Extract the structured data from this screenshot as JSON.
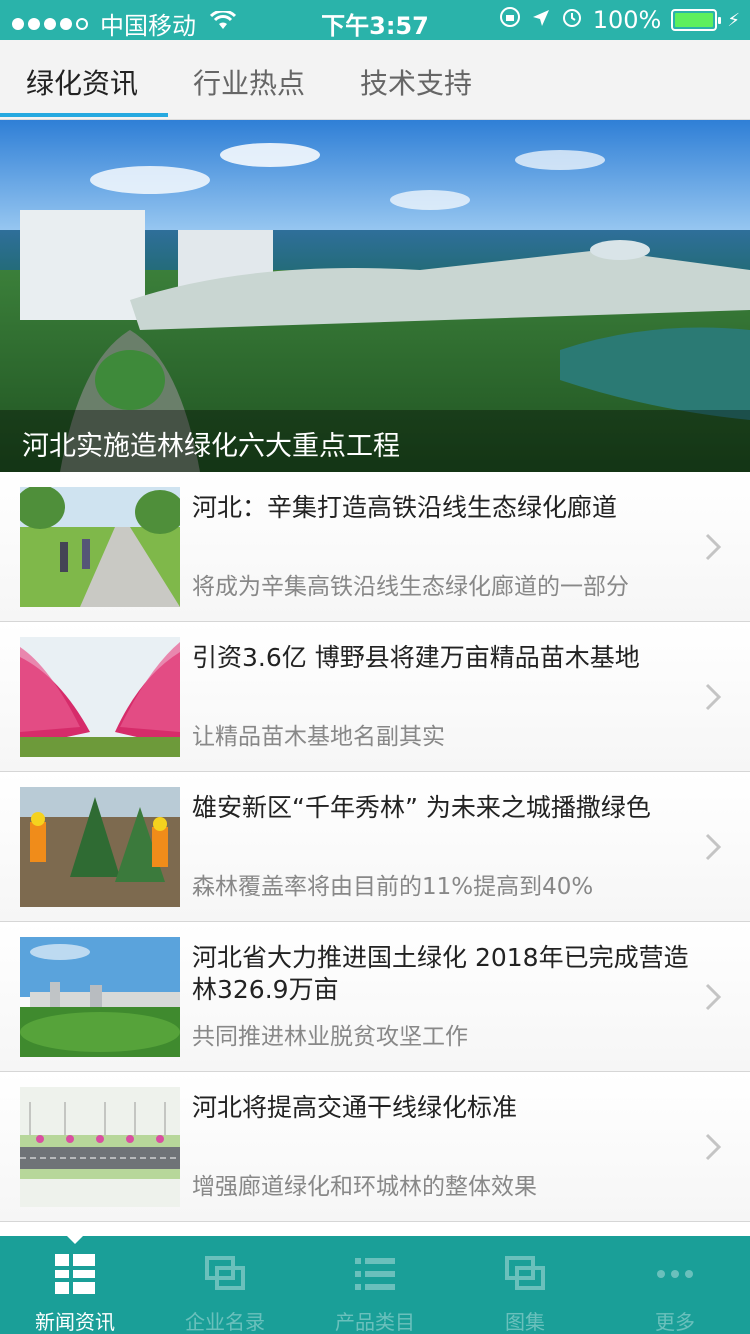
{
  "status_bar": {
    "carrier": "中国移动",
    "time": "下午3:57",
    "battery_percent": "100%",
    "battery_level": 1.0
  },
  "tabs": [
    {
      "label": "绿化资讯",
      "active": true
    },
    {
      "label": "行业热点",
      "active": false
    },
    {
      "label": "技术支持",
      "active": false
    }
  ],
  "banner": {
    "caption": "河北实施造林绿化六大重点工程"
  },
  "news": [
    {
      "title": "河北：辛集打造高铁沿线生态绿化廊道",
      "summary": "将成为辛集高铁沿线生态绿化廊道的一部分",
      "thumb": "road-greenway"
    },
    {
      "title": "引资3.6亿 博野县将建万亩精品苗木基地",
      "summary": "让精品苗木基地名副其实",
      "thumb": "pink-blossom"
    },
    {
      "title": "雄安新区“千年秀林” 为未来之城播撒绿色",
      "summary": "森林覆盖率将由目前的11%提高到40%",
      "thumb": "tree-planting"
    },
    {
      "title": "河北省大力推进国土绿化 2018年已完成营造林326.9万亩",
      "summary": "共同推进林业脱贫攻坚工作",
      "thumb": "city-view"
    },
    {
      "title": "河北将提高交通干线绿化标准",
      "summary": "增强廊道绿化和环城林的整体效果",
      "thumb": "road-plan"
    }
  ],
  "bottom_nav": [
    {
      "label": "新闻资讯",
      "icon": "news-grid-icon",
      "active": true
    },
    {
      "label": "企业名录",
      "icon": "windows-icon",
      "active": false
    },
    {
      "label": "产品类目",
      "icon": "list-icon",
      "active": false
    },
    {
      "label": "图集",
      "icon": "gallery-icon",
      "active": false
    },
    {
      "label": "更多",
      "icon": "more-dots-icon",
      "active": false
    }
  ],
  "colors": {
    "status_bar": "#2ab3aa",
    "bottom_nav": "#1a9f98",
    "tab_indicator": "#26a9e0"
  }
}
